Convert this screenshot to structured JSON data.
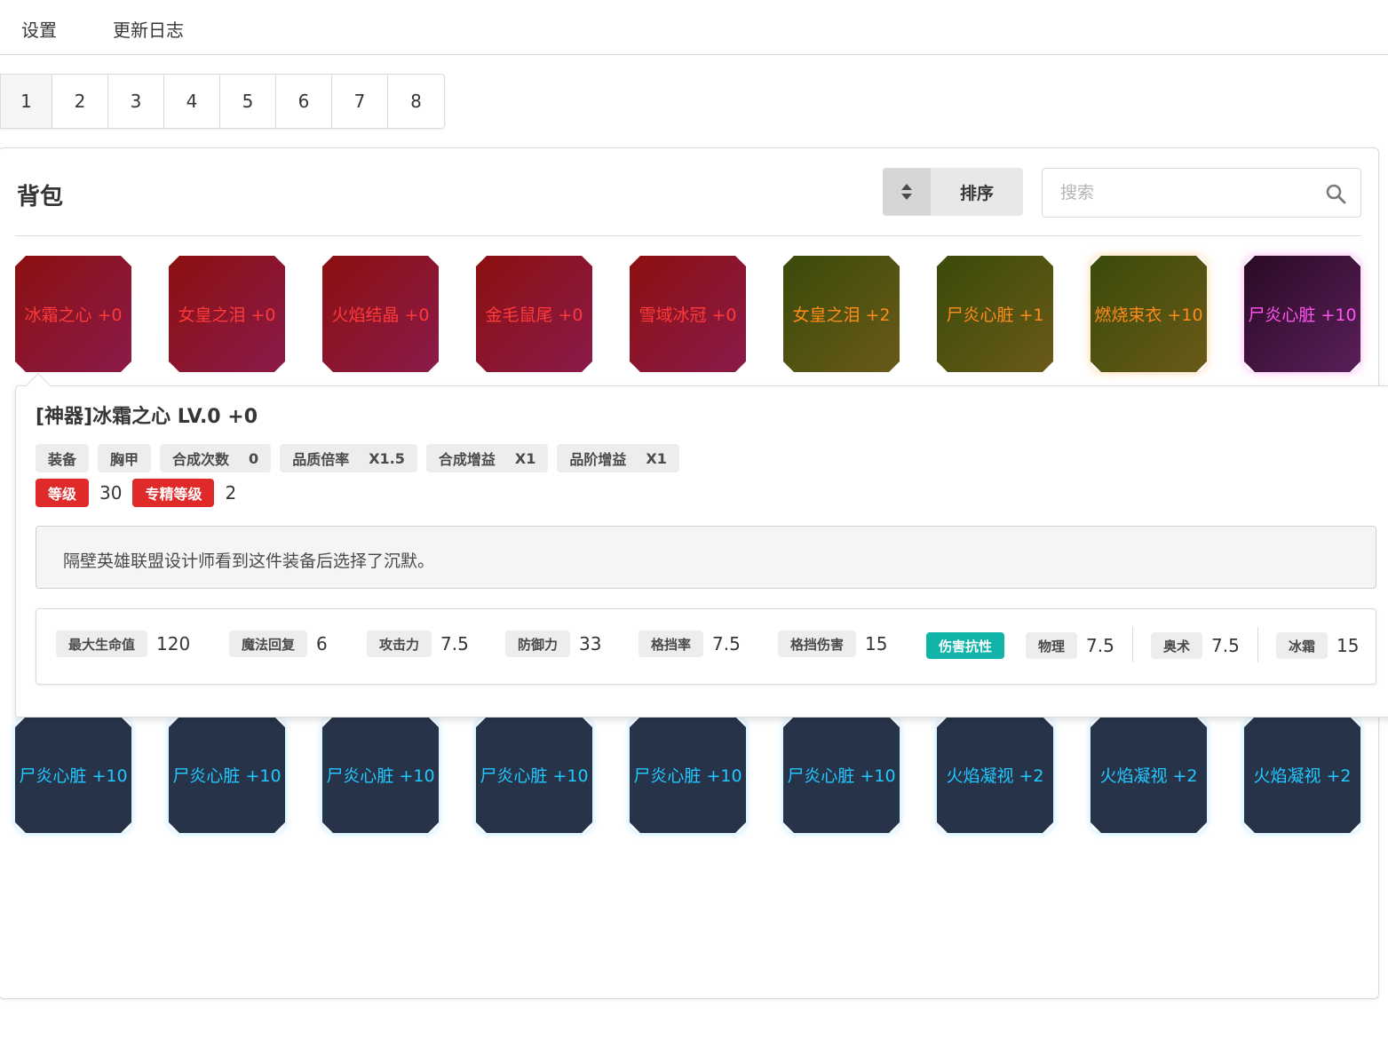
{
  "nav": {
    "settings": "设置",
    "changelog": "更新日志"
  },
  "pages": [
    "1",
    "2",
    "3",
    "4",
    "5",
    "6",
    "7",
    "8"
  ],
  "bag": {
    "title": "背包",
    "sort_label": "排序",
    "sort_icon": "sort-icon",
    "search_placeholder": "搜索",
    "search_icon": "search-icon"
  },
  "items_row1": [
    {
      "label": "冰霜之心 +0",
      "rarity": "red"
    },
    {
      "label": "女皇之泪 +0",
      "rarity": "red"
    },
    {
      "label": "火焰结晶 +0",
      "rarity": "red"
    },
    {
      "label": "金毛鼠尾 +0",
      "rarity": "red"
    },
    {
      "label": "雪域冰冠 +0",
      "rarity": "red"
    },
    {
      "label": "女皇之泪 +2",
      "rarity": "olive"
    },
    {
      "label": "尸炎心脏 +1",
      "rarity": "olive"
    },
    {
      "label": "燃烧束衣 +10",
      "rarity": "olive"
    },
    {
      "label": "尸炎心脏 +10",
      "rarity": "purple"
    }
  ],
  "items_row2": [
    {
      "label": "尸炎心脏 +10",
      "rarity": "navy"
    },
    {
      "label": "尸炎心脏 +10",
      "rarity": "navy"
    },
    {
      "label": "尸炎心脏 +10",
      "rarity": "navy"
    },
    {
      "label": "尸炎心脏 +10",
      "rarity": "navy"
    },
    {
      "label": "尸炎心脏 +10",
      "rarity": "navy"
    },
    {
      "label": "尸炎心脏 +10",
      "rarity": "navy"
    },
    {
      "label": "火焰凝视 +2",
      "rarity": "navy"
    },
    {
      "label": "火焰凝视 +2",
      "rarity": "navy"
    },
    {
      "label": "火焰凝视 +2",
      "rarity": "navy"
    }
  ],
  "detail": {
    "title": "[神器]冰霜之心 LV.0 +0",
    "tags": [
      {
        "label": "装备",
        "value": ""
      },
      {
        "label": "胸甲",
        "value": ""
      },
      {
        "label": "合成次数",
        "value": "0"
      },
      {
        "label": "品质倍率",
        "value": "X1.5"
      },
      {
        "label": "合成增益",
        "value": "X1"
      },
      {
        "label": "品阶增益",
        "value": "X1"
      }
    ],
    "level_label": "等级",
    "level_value": "30",
    "mastery_label": "专精等级",
    "mastery_value": "2",
    "description": "隔壁英雄联盟设计师看到这件装备后选择了沉默。",
    "stats": [
      {
        "label": "最大生命值",
        "value": "120"
      },
      {
        "label": "魔法回复",
        "value": "6"
      },
      {
        "label": "攻击力",
        "value": "7.5"
      },
      {
        "label": "防御力",
        "value": "33"
      },
      {
        "label": "格挡率",
        "value": "7.5"
      },
      {
        "label": "格挡伤害",
        "value": "15"
      }
    ],
    "resist_label": "伤害抗性",
    "resists": [
      {
        "label": "物理",
        "value": "7.5"
      },
      {
        "label": "奥术",
        "value": "7.5"
      },
      {
        "label": "冰霜",
        "value": "15"
      }
    ]
  },
  "colors": {
    "red_text": "#ff3a3a",
    "olive_text": "#ff8c1a",
    "purple_text": "#ff55ee",
    "navy_text": "#22c8ff",
    "badge_red": "#e02a2a",
    "badge_teal": "#12b3a8"
  }
}
